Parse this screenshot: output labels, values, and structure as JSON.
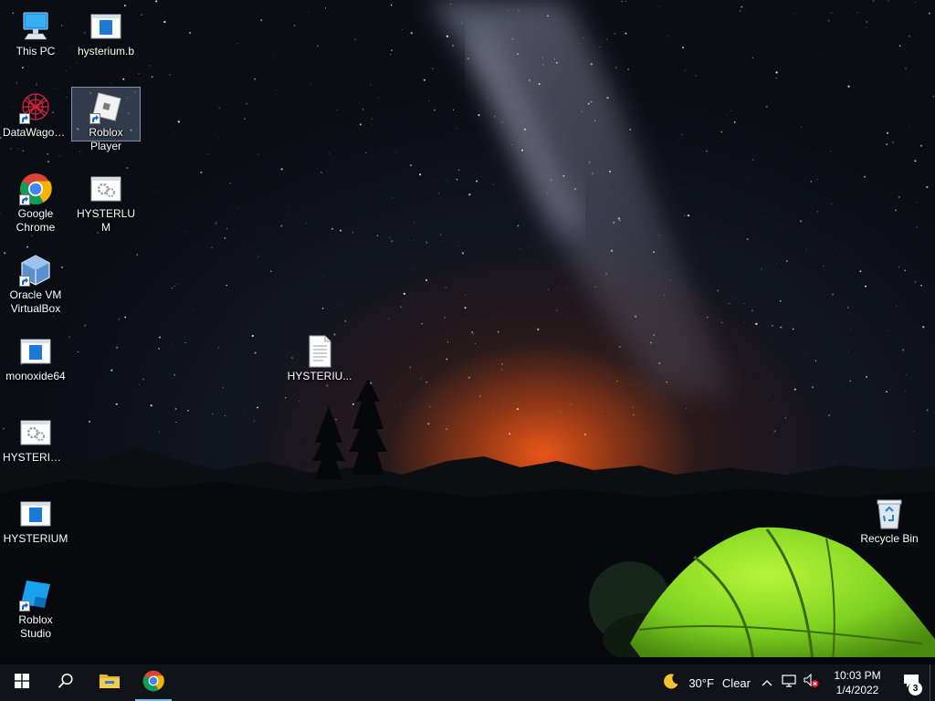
{
  "desktop": {
    "icons": [
      {
        "label": "This PC"
      },
      {
        "label": "hysterium.b"
      },
      {
        "label": "DataWagon..."
      },
      {
        "label": "Roblox Player"
      },
      {
        "label": "Google Chrome"
      },
      {
        "label": "HYSTERLUM"
      },
      {
        "label": "Oracle VM VirtualBox"
      },
      {
        "label": "monoxide64"
      },
      {
        "label": "HYSTERIU..."
      },
      {
        "label": "HYSTERIUM..."
      },
      {
        "label": "HYSTERIUM"
      },
      {
        "label": "Roblox Studio"
      },
      {
        "label": "Recycle Bin"
      }
    ]
  },
  "taskbar": {
    "weather_temp": "30°F",
    "weather_desc": "Clear",
    "clock_time": "10:03 PM",
    "clock_date": "1/4/2022",
    "notification_count": "3"
  },
  "colors": {
    "taskbar_bg": "#101318",
    "accent": "#76b9ed",
    "tent_green": "#8ee02a"
  }
}
